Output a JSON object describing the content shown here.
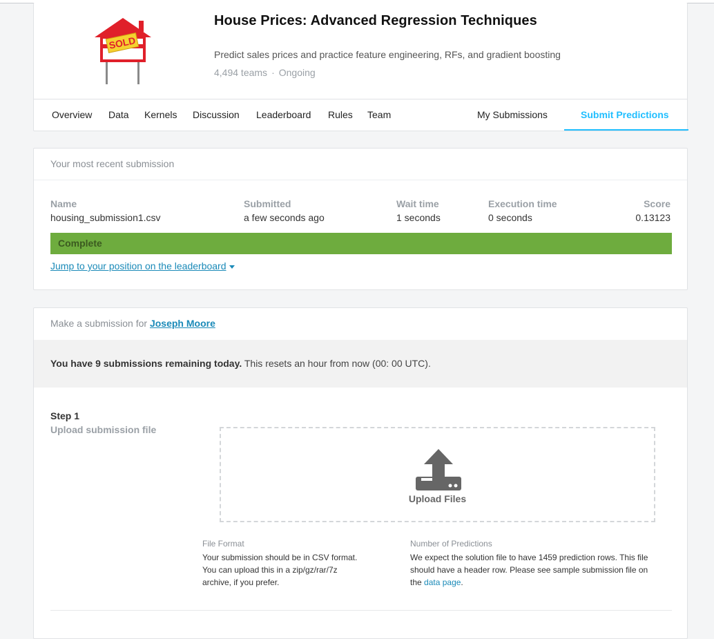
{
  "competition": {
    "title": "House Prices: Advanced Regression Techniques",
    "subtitle": "Predict sales prices and practice feature engineering, RFs, and gradient boosting",
    "teams": "4,494 teams",
    "separator": "·",
    "status": "Ongoing",
    "logo_sign_text": "SOLD",
    "logo_colors": {
      "house": "#e0202a",
      "sign": "#f5d130",
      "posts": "#7a7a7a"
    }
  },
  "tabs": [
    {
      "label": "Overview"
    },
    {
      "label": "Data"
    },
    {
      "label": "Kernels"
    },
    {
      "label": "Discussion"
    },
    {
      "label": "Leaderboard"
    },
    {
      "label": "Rules"
    },
    {
      "label": "Team"
    },
    {
      "label": "My Submissions"
    },
    {
      "label": "Submit Predictions",
      "active": true
    }
  ],
  "recent": {
    "heading": "Your most recent submission",
    "columns": {
      "name": {
        "label": "Name",
        "value": "housing_submission1.csv"
      },
      "submitted": {
        "label": "Submitted",
        "value": "a few seconds ago"
      },
      "wait": {
        "label": "Wait time",
        "value": "1 seconds"
      },
      "execution": {
        "label": "Execution time",
        "value": "0 seconds"
      },
      "score": {
        "label": "Score",
        "value": "0.13123"
      }
    },
    "status": "Complete",
    "status_color": "#6eac3e",
    "jump_link": "Jump to your position on the leaderboard"
  },
  "make": {
    "heading_prefix": "Make a submission for",
    "user": "Joseph Moore",
    "remaining_bold": "You have 9 submissions remaining today.",
    "remaining_rest": "This resets an hour from now (00: 00 UTC).",
    "step_title": "Step 1",
    "step_sub": "Upload submission file",
    "upload_label": "Upload Files",
    "file_format": {
      "title": "File Format",
      "lines": [
        "Your submission should be in CSV format.",
        "You can upload this in a zip/gz/rar/7z",
        "archive, if you prefer."
      ]
    },
    "predictions": {
      "title": "Number of Predictions",
      "line1": "We expect the solution file to have 1459 prediction rows. This file",
      "line2": "should have a header row. Please see sample submission file on",
      "line3_prefix": "the",
      "link": "data page",
      "line3_suffix": "."
    }
  },
  "accent_color": "#20beff",
  "link_color": "#1a8ab8"
}
